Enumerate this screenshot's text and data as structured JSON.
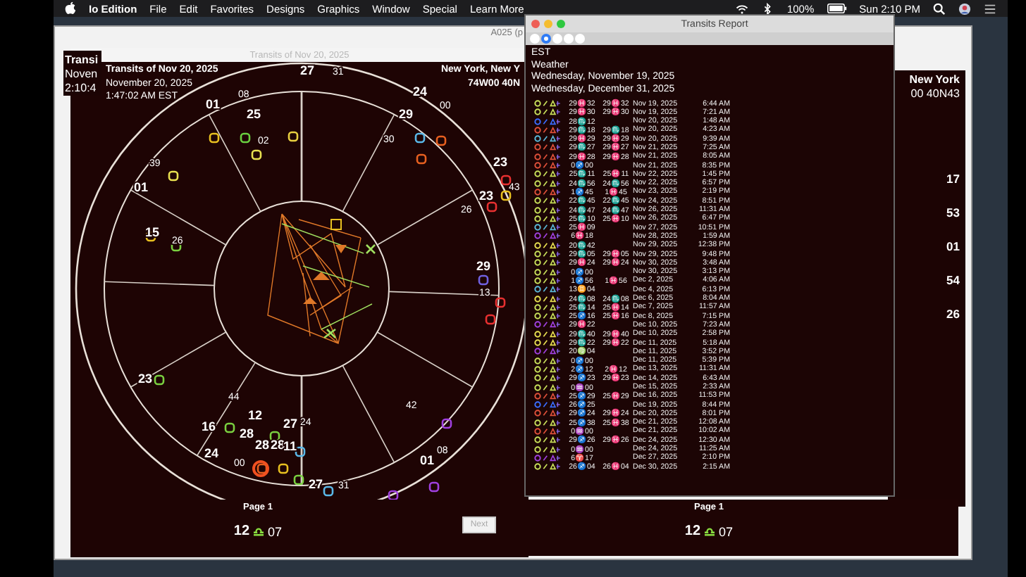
{
  "menu_bar": {
    "app_name": "Io Edition",
    "items": [
      "File",
      "Edit",
      "Favorites",
      "Designs",
      "Graphics",
      "Window",
      "Special",
      "Learn More"
    ],
    "battery": "100%",
    "clock": "Sun 2:10 PM"
  },
  "back_window_left": {
    "lines": [
      "Transi",
      "Noven",
      "2:10:4"
    ]
  },
  "back_window_right": {
    "lines": [
      "New York",
      "00 40N43"
    ],
    "wheel_labels": [
      "17",
      "53",
      "01",
      "54",
      "26"
    ]
  },
  "chart_window": {
    "title": "Transits of Nov 20, 2025",
    "tab_text": "A025 (p",
    "header_left": [
      "Transits of Nov 20, 2025",
      "November 20, 2025",
      "1:47:02 AM EST"
    ],
    "header_right": [
      "New York, New Y",
      "74W00 40N"
    ],
    "wheel_labels": [
      {
        "text": "27",
        "bold": true
      },
      {
        "text": "31",
        "bold": false
      },
      {
        "text": "01",
        "bold": true
      },
      {
        "text": "08",
        "bold": false
      },
      {
        "text": "25",
        "bold": true
      },
      {
        "text": "02",
        "bold": false
      },
      {
        "text": "24",
        "bold": true
      },
      {
        "text": "00",
        "bold": false
      },
      {
        "text": "29",
        "bold": true
      },
      {
        "text": "30",
        "bold": false
      },
      {
        "text": "39",
        "bold": false
      },
      {
        "text": "01",
        "bold": true
      },
      {
        "text": "23",
        "bold": true
      },
      {
        "text": "43",
        "bold": false
      },
      {
        "text": "23",
        "bold": true
      },
      {
        "text": "26",
        "bold": false
      },
      {
        "text": "15",
        "bold": true
      },
      {
        "text": "26",
        "bold": false
      },
      {
        "text": "29",
        "bold": true
      },
      {
        "text": "13",
        "bold": false
      },
      {
        "text": "23",
        "bold": true
      },
      {
        "text": "42",
        "bold": false
      },
      {
        "text": "44",
        "bold": false
      },
      {
        "text": "12",
        "bold": true
      },
      {
        "text": "16",
        "bold": true
      },
      {
        "text": "28",
        "bold": true
      },
      {
        "text": "28",
        "bold": true
      },
      {
        "text": "27",
        "bold": true
      },
      {
        "text": "24",
        "bold": false
      },
      {
        "text": "24",
        "bold": true
      },
      {
        "text": "00",
        "bold": false
      },
      {
        "text": "28",
        "bold": true
      },
      {
        "text": "11",
        "bold": true
      },
      {
        "text": "01",
        "bold": true
      },
      {
        "text": "08",
        "bold": false
      },
      {
        "text": "27",
        "bold": true
      },
      {
        "text": "31",
        "bold": false
      }
    ]
  },
  "bottom": {
    "page_labels": [
      "Page 1",
      "Page 1"
    ],
    "cusp_labels": [
      {
        "degree": "12",
        "minute": "07"
      },
      {
        "degree": "12",
        "minute": "07"
      }
    ],
    "next_button": "Next"
  },
  "transits_report": {
    "title": "Transits Report",
    "toolbar": [
      {
        "selected": false
      },
      {
        "selected": true
      },
      {
        "selected": false
      },
      {
        "selected": false
      },
      {
        "selected": false
      }
    ],
    "header": [
      "EST",
      "Weather",
      "Wednesday, November 19, 2025",
      "Wednesday, December 31, 2025"
    ],
    "rows": [
      {
        "color": "#c8e05a",
        "pos": "29♓32",
        "pos2": "29♓32",
        "date": "Nov 19, 2025",
        "time": "6:44 AM"
      },
      {
        "color": "#c8e05a",
        "pos": "29♓30",
        "pos2": "29♓30",
        "date": "Nov 19, 2025",
        "time": "7:21 AM"
      },
      {
        "color": "#3a6cff",
        "pos": "28♏12",
        "pos2": "",
        "date": "Nov 20, 2025",
        "time": "1:48 AM"
      },
      {
        "color": "#e0503a",
        "pos": "29♏18",
        "pos2": "29♏18",
        "date": "Nov 20, 2025",
        "time": "4:23 AM"
      },
      {
        "color": "#5ab8d8",
        "pos": "29♓29",
        "pos2": "29♓29",
        "date": "Nov 20, 2025",
        "time": "9:39 AM"
      },
      {
        "color": "#e0503a",
        "pos": "29♏27",
        "pos2": "29♓27",
        "date": "Nov 21, 2025",
        "time": "7:25 AM"
      },
      {
        "color": "#e0503a",
        "pos": "29♓28",
        "pos2": "29♓28",
        "date": "Nov 21, 2025",
        "time": "8:05 AM"
      },
      {
        "color": "#e0503a",
        "pos": "0♐00",
        "pos2": "",
        "date": "Nov 21, 2025",
        "time": "8:35 PM"
      },
      {
        "color": "#c8e05a",
        "pos": "25♏11",
        "pos2": "25♓11",
        "date": "Nov 22, 2025",
        "time": "1:45 PM"
      },
      {
        "color": "#c8e05a",
        "pos": "24♏56",
        "pos2": "24♏56",
        "date": "Nov 22, 2025",
        "time": "6:57 PM"
      },
      {
        "color": "#e0503a",
        "pos": "1♐45",
        "pos2": "1♓45",
        "date": "Nov 23, 2025",
        "time": "2:19 PM"
      },
      {
        "color": "#c8e05a",
        "pos": "22♏45",
        "pos2": "22♏45",
        "date": "Nov 24, 2025",
        "time": "8:51 PM"
      },
      {
        "color": "#c8e05a",
        "pos": "24♏47",
        "pos2": "24♏47",
        "date": "Nov 26, 2025",
        "time": "11:31 AM"
      },
      {
        "color": "#c8e05a",
        "pos": "25♏10",
        "pos2": "25♓10",
        "date": "Nov 26, 2025",
        "time": "6:47 PM"
      },
      {
        "color": "#5ab8d8",
        "pos": "25♓09",
        "pos2": "",
        "date": "Nov 27, 2025",
        "time": "10:51 PM"
      },
      {
        "color": "#a040e0",
        "pos": "6♓18",
        "pos2": "",
        "date": "Nov 28, 2025",
        "time": "1:59 AM"
      },
      {
        "color": "#e8e050",
        "pos": "20♏42",
        "pos2": "",
        "date": "Nov 29, 2025",
        "time": "12:38 PM"
      },
      {
        "color": "#c8e05a",
        "pos": "29♏05",
        "pos2": "29♓05",
        "date": "Nov 29, 2025",
        "time": "9:48 PM"
      },
      {
        "color": "#c8e05a",
        "pos": "29♓24",
        "pos2": "29♓24",
        "date": "Nov 30, 2025",
        "time": "3:48 AM"
      },
      {
        "color": "#c8e05a",
        "pos": "0♐00",
        "pos2": "",
        "date": "Nov 30, 2025",
        "time": "3:13 PM"
      },
      {
        "color": "#c8e05a",
        "pos": "1♐56",
        "pos2": "1♓56",
        "date": "Dec 2, 2025",
        "time": "4:06 AM"
      },
      {
        "color": "#5ab8d8",
        "pos": "13♊04",
        "pos2": "",
        "date": "Dec 4, 2025",
        "time": "6:13 PM"
      },
      {
        "color": "#e8e050",
        "pos": "24♏08",
        "pos2": "24♏08",
        "date": "Dec 6, 2025",
        "time": "8:04 AM"
      },
      {
        "color": "#c8e05a",
        "pos": "25♏14",
        "pos2": "25♓14",
        "date": "Dec 7, 2025",
        "time": "11:57 AM"
      },
      {
        "color": "#c8e05a",
        "pos": "25♐16",
        "pos2": "25♓16",
        "date": "Dec 8, 2025",
        "time": "7:15 PM"
      },
      {
        "color": "#a040e0",
        "pos": "29♓22",
        "pos2": "",
        "date": "Dec 10, 2025",
        "time": "7:23 AM"
      },
      {
        "color": "#e8e050",
        "pos": "29♏40",
        "pos2": "29♓40",
        "date": "Dec 10, 2025",
        "time": "2:58 PM"
      },
      {
        "color": "#e8e050",
        "pos": "29♏22",
        "pos2": "29♓22",
        "date": "Dec 11, 2025",
        "time": "5:18 AM"
      },
      {
        "color": "#a040e0",
        "pos": "20♍04",
        "pos2": "",
        "date": "Dec 11, 2025",
        "time": "3:52 PM"
      },
      {
        "color": "#c8e05a",
        "pos": "0♐00",
        "pos2": "",
        "date": "Dec 11, 2025",
        "time": "5:39 PM"
      },
      {
        "color": "#c8e05a",
        "pos": "2♐12",
        "pos2": "2♓12",
        "date": "Dec 13, 2025",
        "time": "11:31 AM"
      },
      {
        "color": "#c8e05a",
        "pos": "29♐23",
        "pos2": "29♓23",
        "date": "Dec 14, 2025",
        "time": "6:43 AM"
      },
      {
        "color": "#c8e05a",
        "pos": "0♒00",
        "pos2": "",
        "date": "Dec 15, 2025",
        "time": "2:33 AM"
      },
      {
        "color": "#e0503a",
        "pos": "25♐29",
        "pos2": "25♓29",
        "date": "Dec 16, 2025",
        "time": "11:53 PM"
      },
      {
        "color": "#3a6cff",
        "pos": "26♐25",
        "pos2": "",
        "date": "Dec 19, 2025",
        "time": "8:44 PM"
      },
      {
        "color": "#e0503a",
        "pos": "29♐24",
        "pos2": "29♓24",
        "date": "Dec 20, 2025",
        "time": "8:01 PM"
      },
      {
        "color": "#c8e05a",
        "pos": "25♐38",
        "pos2": "25♓38",
        "date": "Dec 21, 2025",
        "time": "12:08 AM"
      },
      {
        "color": "#e0503a",
        "pos": "0♒00",
        "pos2": "",
        "date": "Dec 21, 2025",
        "time": "10:02 AM"
      },
      {
        "color": "#c8e05a",
        "pos": "29♐26",
        "pos2": "29♓26",
        "date": "Dec 24, 2025",
        "time": "12:30 AM"
      },
      {
        "color": "#c8e05a",
        "pos": "0♒00",
        "pos2": "",
        "date": "Dec 24, 2025",
        "time": "11:25 AM"
      },
      {
        "color": "#a040e0",
        "pos": "6♈17",
        "pos2": "",
        "date": "Dec 27, 2025",
        "time": "2:10 PM"
      },
      {
        "color": "#c8e05a",
        "pos": "26♐04",
        "pos2": "26♓04",
        "date": "Dec 30, 2025",
        "time": "2:15 AM"
      }
    ]
  }
}
